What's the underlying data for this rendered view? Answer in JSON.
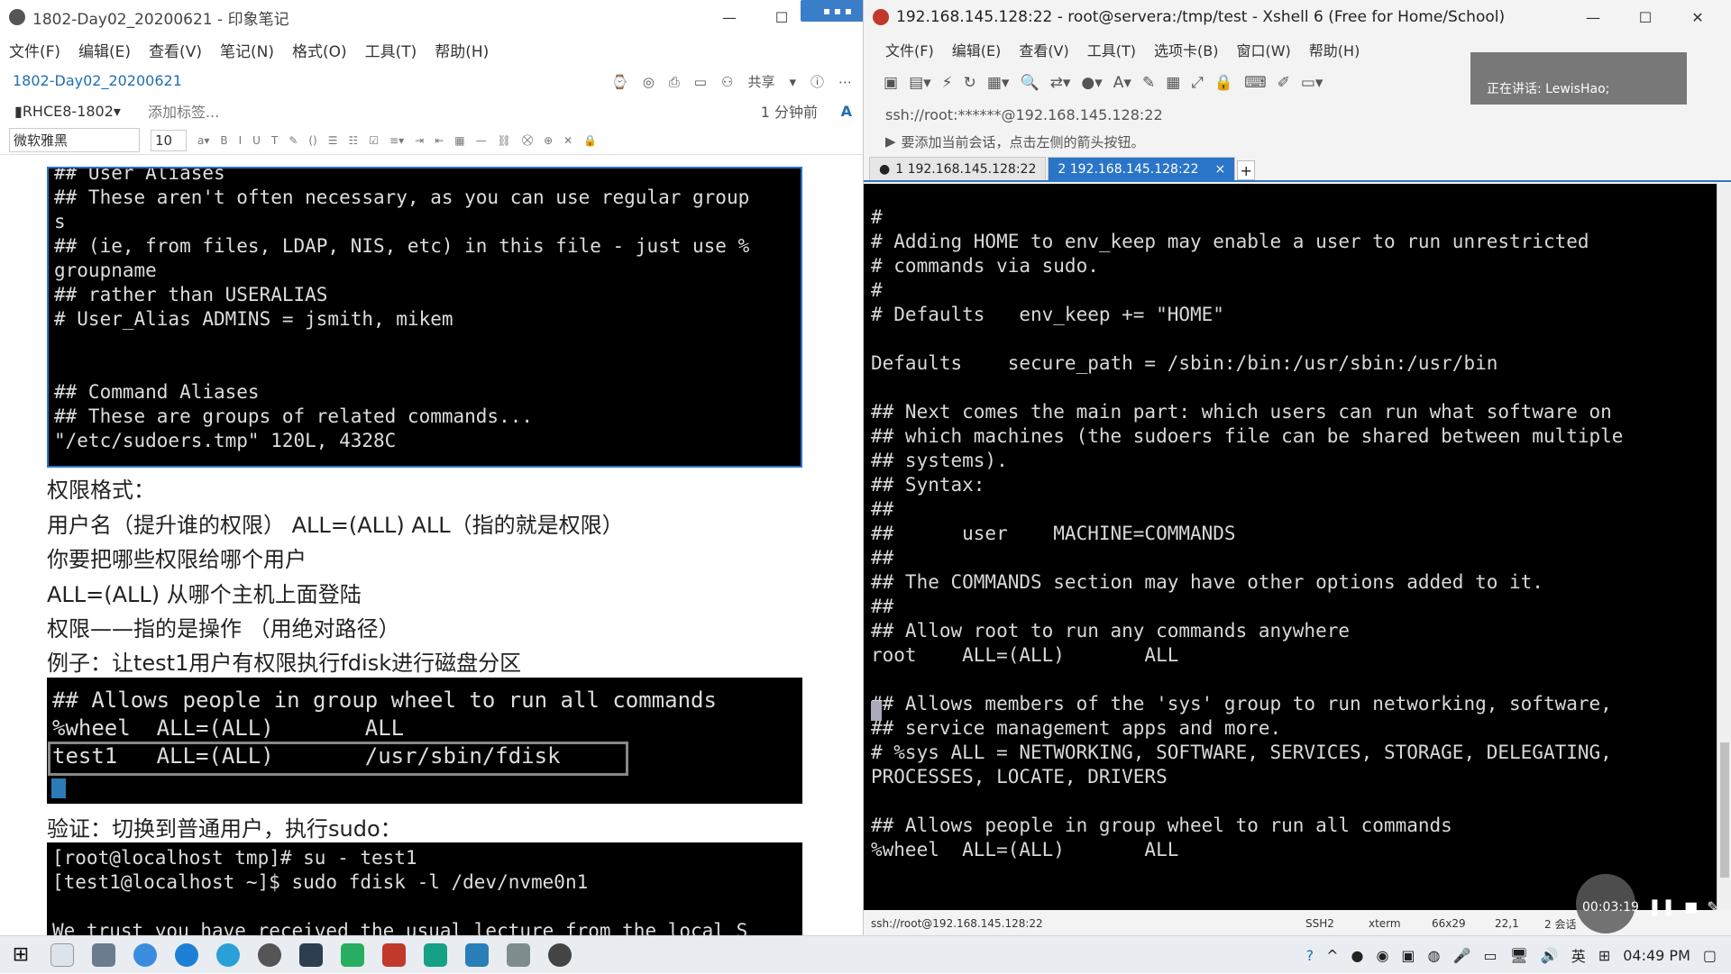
{
  "evernote": {
    "window_title": "1802-Day02_20200621 - 印象笔记",
    "menu": [
      "文件(F)",
      "编辑(E)",
      "查看(V)",
      "笔记(N)",
      "格式(O)",
      "工具(T)",
      "帮助(H)"
    ],
    "note_title": "1802-Day02_20200621",
    "share_label": "共享",
    "notebook": "RHCE8-1802",
    "add_tag": "添加标签...",
    "edited_time": "1 分钟前",
    "font_name": "微软雅黑",
    "font_size": "10",
    "top_terminal_lines": [
      "## User Aliases",
      "## These aren't often necessary, as you can use regular group",
      "s",
      "## (ie, from files, LDAP, NIS, etc) in this file - just use %",
      "groupname",
      "## rather than USERALIAS",
      "# User_Alias ADMINS = jsmith, mikem",
      "",
      "",
      "## Command Aliases",
      "## These are groups of related commands...",
      "\"/etc/sudoers.tmp\" 120L, 4328C"
    ],
    "notes_text": [
      "权限格式：",
      "用户名（提升谁的权限） ALL=(ALL) ALL（指的就是权限）",
      "你要把哪些权限给哪个用户",
      "ALL=(ALL) 从哪个主机上面登陆",
      "权限——指的是操作 （用绝对路径）",
      "例子：让test1用户有权限执行fdisk进行磁盘分区"
    ],
    "mid_terminal_lines": [
      "## Allows people in group wheel to run all commands",
      "%wheel  ALL=(ALL)       ALL",
      "test1   ALL=(ALL)       /usr/sbin/fdisk"
    ],
    "verify_text": "验证：切换到普通用户，执行sudo：",
    "bottom_terminal_lines": [
      "[root@localhost tmp]# su - test1",
      "[test1@localhost ~]$ sudo fdisk -l /dev/nvme0n1",
      "",
      "We trust you have received the usual lecture from the local S"
    ]
  },
  "xshell": {
    "window_title": "192.168.145.128:22 - root@servera:/tmp/test - Xshell 6 (Free for Home/School)",
    "menu": [
      "文件(F)",
      "编辑(E)",
      "查看(V)",
      "工具(T)",
      "选项卡(B)",
      "窗口(W)",
      "帮助(H)"
    ],
    "address": "ssh://root:******@192.168.145.128:22",
    "hint": "要添加当前会话，点击左侧的箭头按钮。",
    "tabs": [
      {
        "label": "1 192.168.145.128:22",
        "active": false
      },
      {
        "label": "2 192.168.145.128:22",
        "active": true
      }
    ],
    "terminal_lines": [
      "#",
      "# Adding HOME to env_keep may enable a user to run unrestricted",
      "# commands via sudo.",
      "#",
      "# Defaults   env_keep += \"HOME\"",
      "",
      "Defaults    secure_path = /sbin:/bin:/usr/sbin:/usr/bin",
      "",
      "## Next comes the main part: which users can run what software on",
      "## which machines (the sudoers file can be shared between multiple",
      "## systems).",
      "## Syntax:",
      "##",
      "##      user    MACHINE=COMMANDS",
      "##",
      "## The COMMANDS section may have other options added to it.",
      "##",
      "## Allow root to run any commands anywhere",
      "root    ALL=(ALL)       ALL",
      "",
      "## Allows members of the 'sys' group to run networking, software,",
      "## service management apps and more.",
      "# %sys ALL = NETWORKING, SOFTWARE, SERVICES, STORAGE, DELEGATING,",
      "PROCESSES, LOCATE, DRIVERS",
      "",
      "## Allows people in group wheel to run all commands",
      "%wheel  ALL=(ALL)       ALL"
    ],
    "status": {
      "conn": "ssh://root@192.168.145.128:22",
      "proto": "SSH2",
      "term": "xterm",
      "size": "66x29",
      "pos": "22,1",
      "sessions": "2 会话"
    },
    "recording": {
      "time": "00:03:19",
      "speaker": "正在讲话: LewisHao;"
    }
  },
  "taskbar": {
    "ime": "英",
    "clock": "04:49 PM"
  },
  "colors": {
    "accent": "#2b75c9",
    "terminal_bg": "#000000",
    "terminal_fg": "#d8d8d8"
  }
}
